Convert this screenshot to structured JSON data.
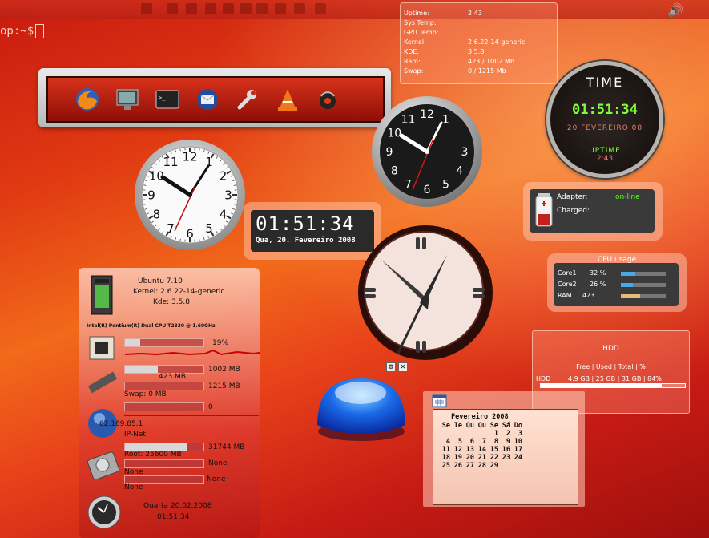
{
  "terminal": {
    "prompt": "op:~$"
  },
  "topbar": {
    "speaker_icon": "speaker-icon"
  },
  "sysinfo": {
    "rows": [
      {
        "label": "Uptime:",
        "value": "2:43"
      },
      {
        "label": "Sys Temp:",
        "value": ""
      },
      {
        "label": "GPU Temp:",
        "value": ""
      },
      {
        "label": "Kernel:",
        "value": "2.6.22-14-generic"
      },
      {
        "label": "KDE:",
        "value": "3.5.8"
      },
      {
        "label": "Ram:",
        "value": "423 / 1002 Mb"
      },
      {
        "label": "Swap:",
        "value": "0 / 1215 Mb"
      }
    ]
  },
  "dock": {
    "items": [
      "firefox-icon",
      "monitor-icon",
      "terminal-icon",
      "thunderbird-icon",
      "wrench-icon",
      "vlc-icon",
      "audio-player-icon"
    ]
  },
  "clocks": {
    "white_numbers": [
      "12",
      "1",
      "2",
      "3",
      "4",
      "5",
      "6",
      "7",
      "8",
      "9",
      "10",
      "11"
    ],
    "black_numbers": [
      "12",
      "1",
      "3",
      "4",
      "5",
      "6",
      "7",
      "8",
      "9",
      "10",
      "11"
    ]
  },
  "digital_clock": {
    "time": "01:51:34",
    "date": "Qua, 20. Fevereiro 2008"
  },
  "time_widget": {
    "title": "TIME",
    "time": "01:51:34",
    "date": "20 FEVEREIRO 08",
    "uptime_label": "UPTIME",
    "uptime_value": "2:43"
  },
  "battery": {
    "adapter_label": "Adapter:",
    "adapter_value": "on-line",
    "charged_label": "Charged:"
  },
  "cpu_usage": {
    "title": "CPU usage",
    "rows": [
      {
        "label": "Core1",
        "value": "32 %",
        "level": 0.32
      },
      {
        "label": "Core2",
        "value": "26 %",
        "level": 0.26
      },
      {
        "label": "RAM",
        "value": "423",
        "level": 0.42
      }
    ]
  },
  "hdd": {
    "title": "HDD",
    "header": "Free | Used | Total | %",
    "label": "HDD",
    "values": "4.9 GB | 25 GB | 31 GB | 84%",
    "level": 0.84
  },
  "calendar": {
    "month": "Fevereiro 2008",
    "weekdays": [
      "Se",
      "Te",
      "Qu",
      "Qu",
      "Se",
      "Sá",
      "Do"
    ],
    "weeks": [
      [
        "",
        "",
        "",
        "",
        "1",
        "2",
        "3"
      ],
      [
        "4",
        "5",
        "6",
        "7",
        "8",
        "9",
        "10"
      ],
      [
        "11",
        "12",
        "13",
        "14",
        "15",
        "16",
        "17"
      ],
      [
        "18",
        "19",
        "20",
        "21",
        "22",
        "23",
        "24"
      ],
      [
        "25",
        "26",
        "27",
        "28",
        "29",
        "",
        ""
      ]
    ]
  },
  "sysmon": {
    "os": "Ubuntu 7.10",
    "kernel": "Kernel: 2.6.22-14-generic",
    "kde": "Kde: 3.5.8",
    "cpu_model": "Intel(R) Pentium(R) Dual  CPU  T2330  @ 1.60GHz",
    "cpu_percent": "19%",
    "cpu_level": 0.19,
    "ram_text": "1002 MB",
    "ram_used": "423 MB",
    "ram_level": 0.42,
    "swap_total": "1215 MB",
    "swap_used": "Swap: 0 MB",
    "net_value": "0",
    "ip": "62.169.85.1",
    "ip_net": "IP-Net:",
    "root_total": "31744 MB",
    "root_used": "Root: 25600 MB",
    "root_level": 0.8,
    "disk1_label": "None",
    "disk1_value": "None",
    "disk2_label": "None",
    "disk2_value": "None",
    "date": "Quarta 20.02.2008",
    "time": "01:51:34"
  },
  "big_clock_controls": [
    "settings-icon",
    "close-icon"
  ]
}
